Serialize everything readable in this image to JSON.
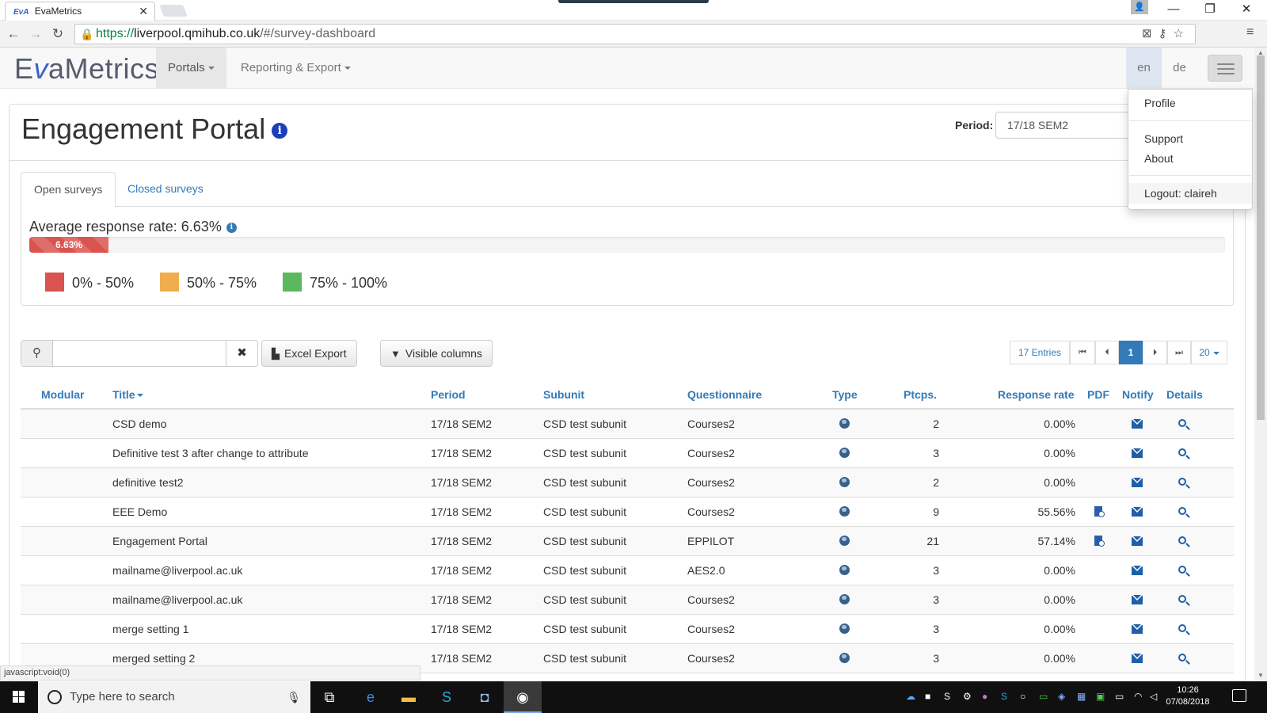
{
  "browser": {
    "tab_title": "EvaMetrics",
    "tab_close": "✕",
    "url_scheme": "https://",
    "url_host": "liverpool.qmihub.co.uk",
    "url_path": "/#/survey-dashboard",
    "status_text": "javascript:void(0)"
  },
  "app": {
    "logo_text_pre": "E",
    "logo_text_v": "v",
    "logo_text_post": "aMetrics",
    "nav": [
      {
        "label": "Portals"
      },
      {
        "label": "Reporting & Export"
      }
    ],
    "langs": [
      "en",
      "de"
    ],
    "menu": {
      "profile": "Profile",
      "support": "Support",
      "about": "About",
      "logout": "Logout: claireh"
    }
  },
  "page": {
    "title": "Engagement Portal",
    "period_label": "Period:",
    "period_value": "17/18 SEM2",
    "tabs": [
      "Open surveys",
      "Closed surveys"
    ],
    "avg_label": "Average response rate: 6.63%",
    "avg_fraction": 0.0663,
    "avg_bar_text": "6.63%",
    "legend": [
      {
        "label": "0% - 50%",
        "color": "#d9534f"
      },
      {
        "label": "50% - 75%",
        "color": "#f0ad4e"
      },
      {
        "label": "75% - 100%",
        "color": "#5cb85c"
      }
    ]
  },
  "toolbar": {
    "search_value": "",
    "excel_label": "Excel Export",
    "columns_label": "Visible columns",
    "entries_label": "17 Entries",
    "current_page": "1",
    "page_size": "20"
  },
  "table": {
    "headers": {
      "modular": "Modular",
      "title": "Title",
      "period": "Period",
      "subunit": "Subunit",
      "questionnaire": "Questionnaire",
      "type": "Type",
      "ptcps": "Ptcps.",
      "rate": "Response rate",
      "pdf": "PDF",
      "notify": "Notify",
      "details": "Details"
    },
    "rows": [
      {
        "title": "CSD demo",
        "period": "17/18 SEM2",
        "subunit": "CSD test subunit",
        "questionnaire": "Courses2",
        "ptcps": "2",
        "rate": "0.00%",
        "pdf": false
      },
      {
        "title": "Definitive test 3 after change to attribute",
        "period": "17/18 SEM2",
        "subunit": "CSD test subunit",
        "questionnaire": "Courses2",
        "ptcps": "3",
        "rate": "0.00%",
        "pdf": false
      },
      {
        "title": "definitive test2",
        "period": "17/18 SEM2",
        "subunit": "CSD test subunit",
        "questionnaire": "Courses2",
        "ptcps": "2",
        "rate": "0.00%",
        "pdf": false
      },
      {
        "title": "EEE Demo",
        "period": "17/18 SEM2",
        "subunit": "CSD test subunit",
        "questionnaire": "Courses2",
        "ptcps": "9",
        "rate": "55.56%",
        "pdf": true
      },
      {
        "title": "Engagement Portal",
        "period": "17/18 SEM2",
        "subunit": "CSD test subunit",
        "questionnaire": "EPPILOT",
        "ptcps": "21",
        "rate": "57.14%",
        "pdf": true
      },
      {
        "title": "mailname@liverpool.ac.uk",
        "period": "17/18 SEM2",
        "subunit": "CSD test subunit",
        "questionnaire": "AES2.0",
        "ptcps": "3",
        "rate": "0.00%",
        "pdf": false
      },
      {
        "title": "mailname@liverpool.ac.uk",
        "period": "17/18 SEM2",
        "subunit": "CSD test subunit",
        "questionnaire": "Courses2",
        "ptcps": "3",
        "rate": "0.00%",
        "pdf": false
      },
      {
        "title": "merge setting 1",
        "period": "17/18 SEM2",
        "subunit": "CSD test subunit",
        "questionnaire": "Courses2",
        "ptcps": "3",
        "rate": "0.00%",
        "pdf": false
      },
      {
        "title": "merged setting 2",
        "period": "17/18 SEM2",
        "subunit": "CSD test subunit",
        "questionnaire": "Courses2",
        "ptcps": "3",
        "rate": "0.00%",
        "pdf": false
      }
    ]
  },
  "taskbar": {
    "search_placeholder": "Type here to search",
    "time": "10:26",
    "date": "07/08/2018"
  }
}
